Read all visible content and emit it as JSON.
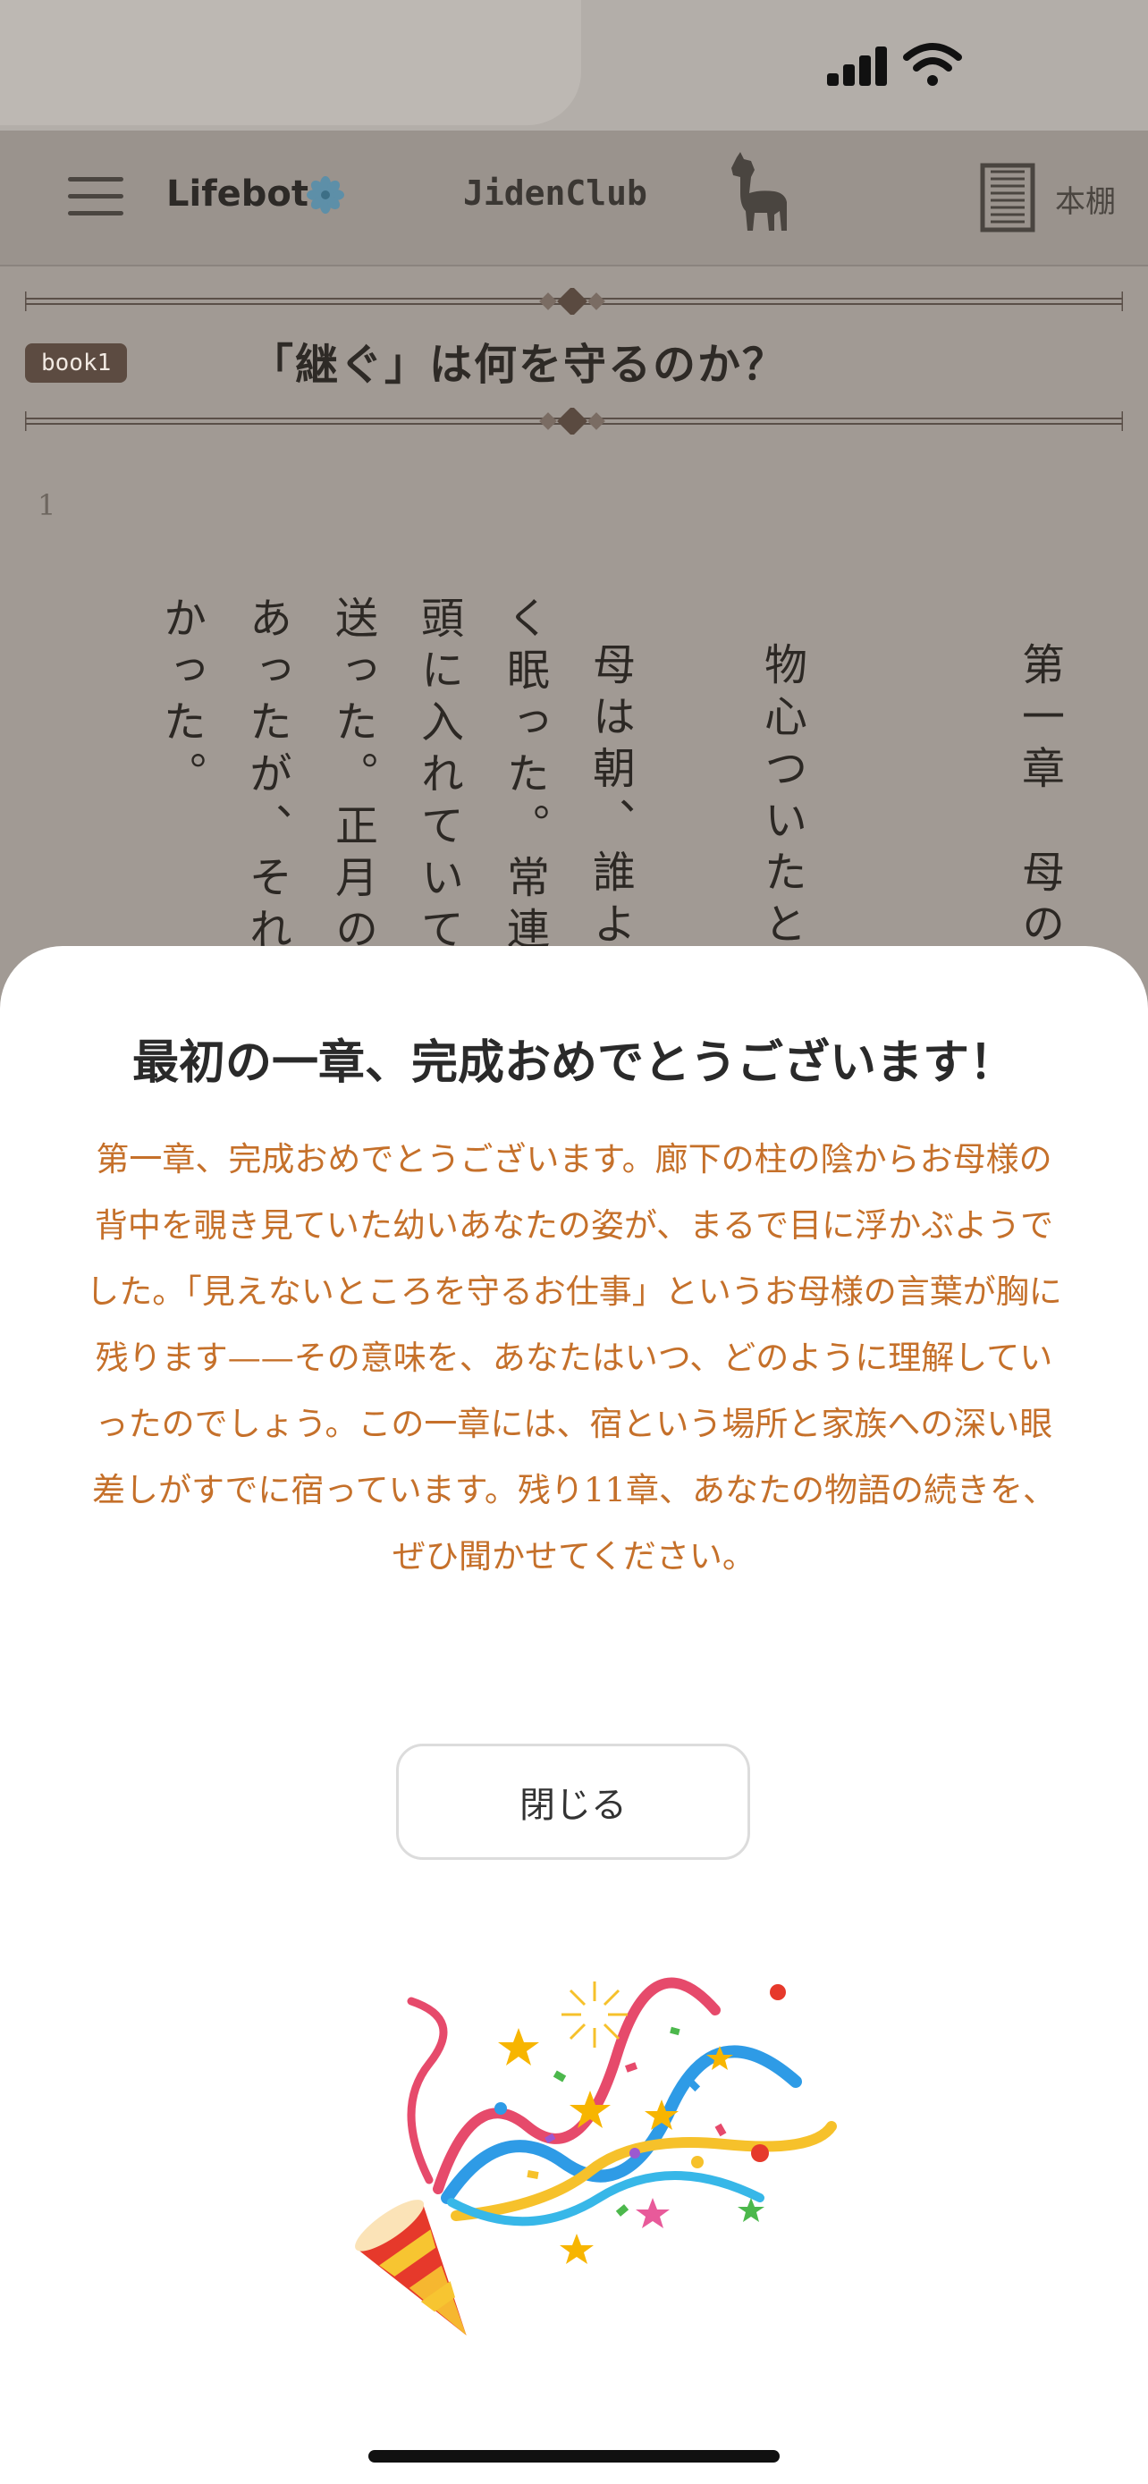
{
  "status_bar": {
    "signal_icon": "signal-icon",
    "wifi_icon": "wifi-icon"
  },
  "header": {
    "menu_icon": "hamburger-icon",
    "brand": "Lifebot",
    "brand_icon": "flower-icon",
    "club": "JidenClub",
    "mascot_icon": "alpaca-icon",
    "shelf_icon": "bookshelf-icon",
    "shelf_label": "本棚"
  },
  "book": {
    "badge": "book1",
    "title": "「継ぐ」は何を守るのか？",
    "page_number": "1",
    "columns": [
      "第一章　母の",
      "物心ついたとき",
      "母は朝、誰より",
      "く眠った。常連客",
      "頭に入れていて、",
      "送った。正月の箸",
      "あったが、それで",
      "かった。"
    ]
  },
  "modal": {
    "title": "最初の一章、完成おめでとうございます！",
    "message": "第一章、完成おめでとうございます。廊下の柱の陰からお母様の背中を覗き見ていた幼いあなたの姿が、まるで目に浮かぶようでした。「見えないところを守るお仕事」というお母様の言葉が胸に残ります——その意味を、あなたはいつ、どのように理解していったのでしょう。この一章には、宿という場所と家族への深い眼差しがすでに宿っています。残り11章、あなたの物語の続きを、ぜひ聞かせてください。",
    "close_label": "閉じる",
    "illustration_icon": "party-popper-icon"
  },
  "colors": {
    "accent_text": "#c5702a",
    "badge_bg": "#5c4b41",
    "overlay": "#a19a94"
  }
}
